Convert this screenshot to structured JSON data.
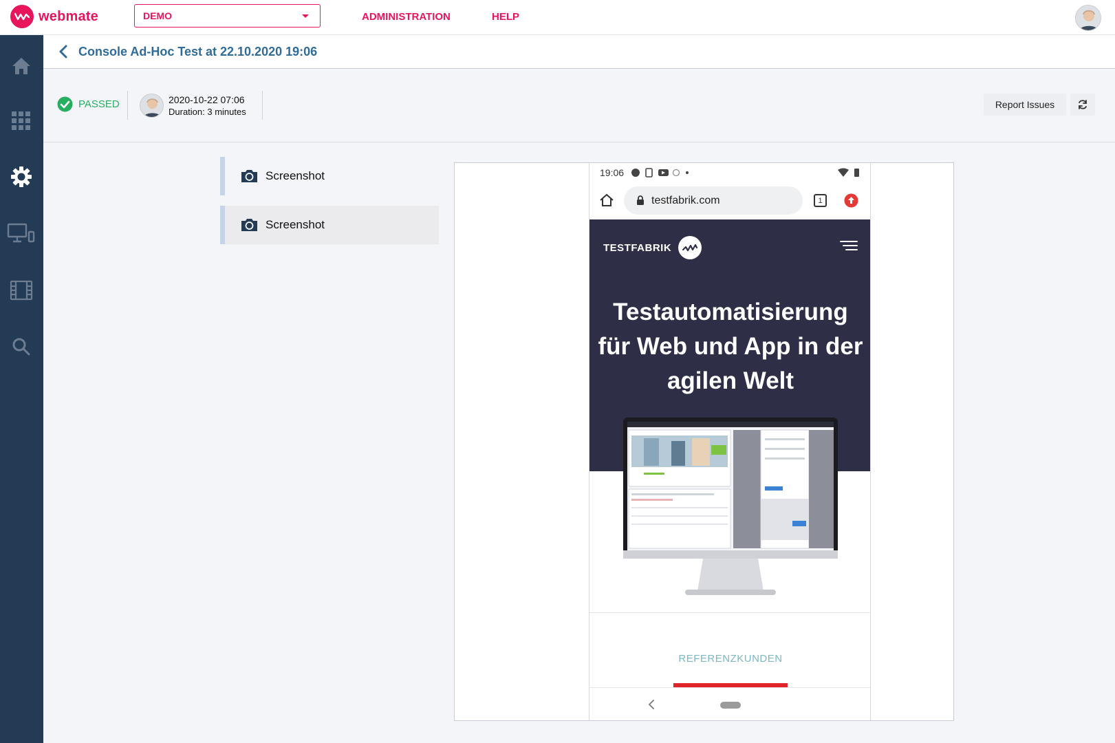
{
  "app": {
    "logo_text": "webmate",
    "project_selector": "DEMO",
    "nav": {
      "administration": "ADMINISTRATION",
      "help": "HELP"
    }
  },
  "page": {
    "title": "Console Ad-Hoc Test at 22.10.2020 19:06"
  },
  "run": {
    "status": "PASSED",
    "date": "2020-10-22 07:06",
    "duration": "Duration: 3 minutes"
  },
  "actions": {
    "report_issues": "Report Issues"
  },
  "steps": [
    {
      "label": "Screenshot",
      "icon": "camera-icon",
      "active": false
    },
    {
      "label": "Screenshot",
      "icon": "camera-icon",
      "active": true
    }
  ],
  "device_preview": {
    "status_time": "19:06",
    "url": "testfabrik.com",
    "tab_count": "1",
    "site": {
      "brand": "TESTFABRIK",
      "headline_lines": [
        "Testautomatisierung",
        "für Web und App in der",
        "agilen Welt"
      ],
      "section_label": "REFERENZKUNDEN"
    }
  },
  "colors": {
    "brand_pink": "#e6155c",
    "sidebar": "#243b55",
    "title_blue": "#2f6c99",
    "passed_green": "#27ae60",
    "hero_dark": "#2e2e47",
    "ref_teal": "#7bb8c1",
    "ref_red": "#e0252a"
  }
}
